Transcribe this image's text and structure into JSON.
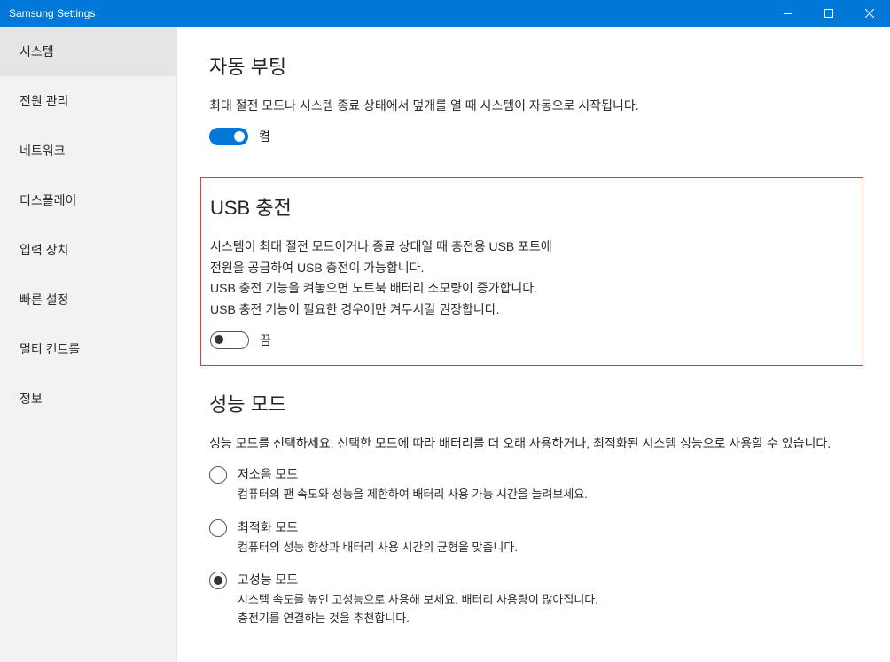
{
  "titlebar": {
    "title": "Samsung Settings"
  },
  "sidebar": {
    "items": [
      {
        "label": "시스템",
        "active": true
      },
      {
        "label": "전원 관리",
        "active": false
      },
      {
        "label": "네트워크",
        "active": false
      },
      {
        "label": "디스플레이",
        "active": false
      },
      {
        "label": "입력 장치",
        "active": false
      },
      {
        "label": "빠른 설정",
        "active": false
      },
      {
        "label": "멀티 컨트롤",
        "active": false
      },
      {
        "label": "정보",
        "active": false
      }
    ]
  },
  "sections": {
    "autoBoot": {
      "title": "자동 부팅",
      "desc": "최대 절전 모드나 시스템 종료 상태에서 덮개를 열 때 시스템이 자동으로 시작됩니다.",
      "toggle": {
        "state": "on",
        "label": "켬"
      }
    },
    "usbCharging": {
      "title": "USB 충전",
      "desc_line1": "시스템이 최대 절전 모드이거나 종료 상태일 때 충전용 USB 포트에",
      "desc_line2": "전원을 공급하여 USB 충전이 가능합니다.",
      "desc_line3": "USB 충전 기능을 켜놓으면 노트북 배터리 소모량이 증가합니다.",
      "desc_line4": "USB 충전 기능이 필요한 경우에만 켜두시길 권장합니다.",
      "toggle": {
        "state": "off",
        "label": "끔"
      }
    },
    "perfMode": {
      "title": "성능 모드",
      "desc": "성능 모드를 선택하세요. 선택한 모드에 따라 배터리를 더 오래 사용하거나, 최적화된 시스템 성능으로 사용할 수 있습니다.",
      "options": [
        {
          "label": "저소음 모드",
          "desc": "컴퓨터의 팬 속도와 성능을 제한하여 배터리 사용 가능 시간을 늘려보세요.",
          "selected": false
        },
        {
          "label": "최적화 모드",
          "desc": "컴퓨터의 성능 향상과 배터리 사용 시간의 균형을 맞춥니다.",
          "selected": false
        },
        {
          "label": "고성능 모드",
          "desc": "시스템 속도를 높인 고성능으로 사용해 보세요. 배터리 사용량이 많아집니다.\n충전기를 연결하는 것을 추천합니다.",
          "selected": true
        }
      ]
    }
  }
}
